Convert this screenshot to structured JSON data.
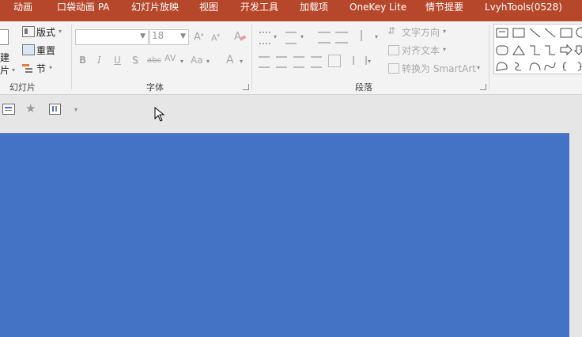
{
  "tabs": [
    {
      "label": "动画"
    },
    {
      "label": "口袋动画 PA"
    },
    {
      "label": "幻灯片放映"
    },
    {
      "label": "视图"
    },
    {
      "label": "开发工具"
    },
    {
      "label": "加载项"
    },
    {
      "label": "OneKey Lite"
    },
    {
      "label": "情节提要"
    },
    {
      "label": "LvyhTools(0528)"
    }
  ],
  "colors": {
    "tabbar": "#b7472a",
    "slide": "#4472c4",
    "ribbon": "#f3f3f3"
  },
  "slides_group": {
    "new_slide_top": "建",
    "new_slide_bottom": "片",
    "layout_label": "版式",
    "reset_label": "重置",
    "section_label": "节",
    "group_label": "幻灯片"
  },
  "font_group": {
    "font_name": "",
    "font_size": "18",
    "group_label": "字体"
  },
  "paragraph_group": {
    "text_direction": "文字方向",
    "align_text": "对齐文本",
    "convert_smartart": "转换为 SmartArt",
    "group_label": "段落"
  }
}
